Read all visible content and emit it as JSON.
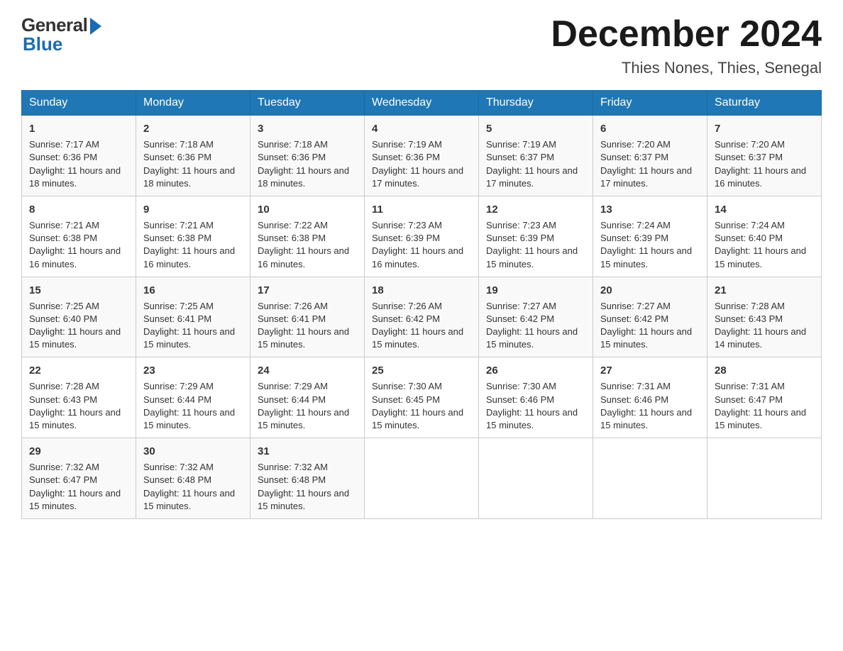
{
  "logo": {
    "general": "General",
    "blue": "Blue"
  },
  "title": "December 2024",
  "location": "Thies Nones, Thies, Senegal",
  "days_of_week": [
    "Sunday",
    "Monday",
    "Tuesday",
    "Wednesday",
    "Thursday",
    "Friday",
    "Saturday"
  ],
  "weeks": [
    [
      {
        "day": "1",
        "sunrise": "7:17 AM",
        "sunset": "6:36 PM",
        "daylight": "11 hours and 18 minutes."
      },
      {
        "day": "2",
        "sunrise": "7:18 AM",
        "sunset": "6:36 PM",
        "daylight": "11 hours and 18 minutes."
      },
      {
        "day": "3",
        "sunrise": "7:18 AM",
        "sunset": "6:36 PM",
        "daylight": "11 hours and 18 minutes."
      },
      {
        "day": "4",
        "sunrise": "7:19 AM",
        "sunset": "6:36 PM",
        "daylight": "11 hours and 17 minutes."
      },
      {
        "day": "5",
        "sunrise": "7:19 AM",
        "sunset": "6:37 PM",
        "daylight": "11 hours and 17 minutes."
      },
      {
        "day": "6",
        "sunrise": "7:20 AM",
        "sunset": "6:37 PM",
        "daylight": "11 hours and 17 minutes."
      },
      {
        "day": "7",
        "sunrise": "7:20 AM",
        "sunset": "6:37 PM",
        "daylight": "11 hours and 16 minutes."
      }
    ],
    [
      {
        "day": "8",
        "sunrise": "7:21 AM",
        "sunset": "6:38 PM",
        "daylight": "11 hours and 16 minutes."
      },
      {
        "day": "9",
        "sunrise": "7:21 AM",
        "sunset": "6:38 PM",
        "daylight": "11 hours and 16 minutes."
      },
      {
        "day": "10",
        "sunrise": "7:22 AM",
        "sunset": "6:38 PM",
        "daylight": "11 hours and 16 minutes."
      },
      {
        "day": "11",
        "sunrise": "7:23 AM",
        "sunset": "6:39 PM",
        "daylight": "11 hours and 16 minutes."
      },
      {
        "day": "12",
        "sunrise": "7:23 AM",
        "sunset": "6:39 PM",
        "daylight": "11 hours and 15 minutes."
      },
      {
        "day": "13",
        "sunrise": "7:24 AM",
        "sunset": "6:39 PM",
        "daylight": "11 hours and 15 minutes."
      },
      {
        "day": "14",
        "sunrise": "7:24 AM",
        "sunset": "6:40 PM",
        "daylight": "11 hours and 15 minutes."
      }
    ],
    [
      {
        "day": "15",
        "sunrise": "7:25 AM",
        "sunset": "6:40 PM",
        "daylight": "11 hours and 15 minutes."
      },
      {
        "day": "16",
        "sunrise": "7:25 AM",
        "sunset": "6:41 PM",
        "daylight": "11 hours and 15 minutes."
      },
      {
        "day": "17",
        "sunrise": "7:26 AM",
        "sunset": "6:41 PM",
        "daylight": "11 hours and 15 minutes."
      },
      {
        "day": "18",
        "sunrise": "7:26 AM",
        "sunset": "6:42 PM",
        "daylight": "11 hours and 15 minutes."
      },
      {
        "day": "19",
        "sunrise": "7:27 AM",
        "sunset": "6:42 PM",
        "daylight": "11 hours and 15 minutes."
      },
      {
        "day": "20",
        "sunrise": "7:27 AM",
        "sunset": "6:42 PM",
        "daylight": "11 hours and 15 minutes."
      },
      {
        "day": "21",
        "sunrise": "7:28 AM",
        "sunset": "6:43 PM",
        "daylight": "11 hours and 14 minutes."
      }
    ],
    [
      {
        "day": "22",
        "sunrise": "7:28 AM",
        "sunset": "6:43 PM",
        "daylight": "11 hours and 15 minutes."
      },
      {
        "day": "23",
        "sunrise": "7:29 AM",
        "sunset": "6:44 PM",
        "daylight": "11 hours and 15 minutes."
      },
      {
        "day": "24",
        "sunrise": "7:29 AM",
        "sunset": "6:44 PM",
        "daylight": "11 hours and 15 minutes."
      },
      {
        "day": "25",
        "sunrise": "7:30 AM",
        "sunset": "6:45 PM",
        "daylight": "11 hours and 15 minutes."
      },
      {
        "day": "26",
        "sunrise": "7:30 AM",
        "sunset": "6:46 PM",
        "daylight": "11 hours and 15 minutes."
      },
      {
        "day": "27",
        "sunrise": "7:31 AM",
        "sunset": "6:46 PM",
        "daylight": "11 hours and 15 minutes."
      },
      {
        "day": "28",
        "sunrise": "7:31 AM",
        "sunset": "6:47 PM",
        "daylight": "11 hours and 15 minutes."
      }
    ],
    [
      {
        "day": "29",
        "sunrise": "7:32 AM",
        "sunset": "6:47 PM",
        "daylight": "11 hours and 15 minutes."
      },
      {
        "day": "30",
        "sunrise": "7:32 AM",
        "sunset": "6:48 PM",
        "daylight": "11 hours and 15 minutes."
      },
      {
        "day": "31",
        "sunrise": "7:32 AM",
        "sunset": "6:48 PM",
        "daylight": "11 hours and 15 minutes."
      },
      null,
      null,
      null,
      null
    ]
  ]
}
